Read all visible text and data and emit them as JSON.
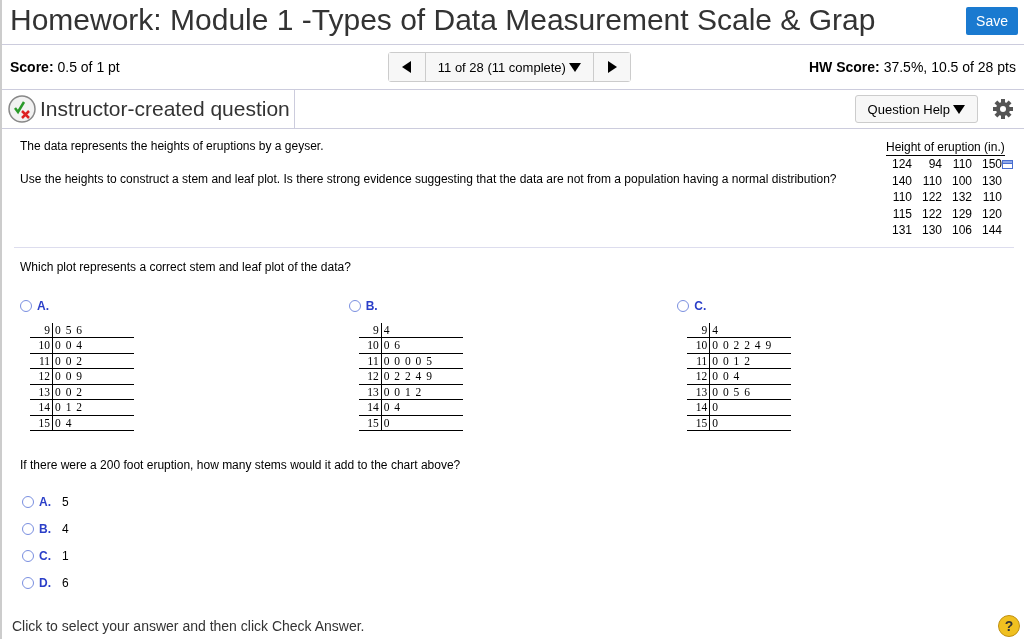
{
  "header": {
    "title": "Homework: Module 1 -Types of Data Measurement Scale & Grap",
    "save_button": "Save"
  },
  "score_bar": {
    "score_label": "Score:",
    "score": "0.5 of 1 pt",
    "nav": "11 of 28 (11 complete)",
    "hw_score_label": "HW Score:",
    "hw_score": "37.5%, 10.5 of 28 pts"
  },
  "question_bar": {
    "title": "Instructor-created question",
    "help_button": "Question Help"
  },
  "problem": {
    "intro": "The data represents the heights of eruptions by a geyser.",
    "task": "Use the heights to construct a stem and leaf plot. Is there strong evidence suggesting that the data are not from a population having a normal distribution?",
    "data_table": {
      "title": "Height of eruption (in.)",
      "rows": [
        [
          "124",
          "94",
          "110",
          "150"
        ],
        [
          "140",
          "110",
          "100",
          "130"
        ],
        [
          "110",
          "122",
          "132",
          "110"
        ],
        [
          "115",
          "122",
          "129",
          "120"
        ],
        [
          "131",
          "130",
          "106",
          "144"
        ]
      ]
    }
  },
  "part1": {
    "prompt": "Which plot represents a correct stem and leaf plot of the data?",
    "choices": [
      {
        "letter": "A.",
        "selected": false,
        "rows": [
          [
            "9",
            "0 5 6"
          ],
          [
            "10",
            "0 0 4"
          ],
          [
            "11",
            "0 0 2"
          ],
          [
            "12",
            "0 0 9"
          ],
          [
            "13",
            "0 0 2"
          ],
          [
            "14",
            "0 1 2"
          ],
          [
            "15",
            "0 4"
          ]
        ]
      },
      {
        "letter": "B.",
        "selected": false,
        "rows": [
          [
            "9",
            "4"
          ],
          [
            "10",
            "0 6"
          ],
          [
            "11",
            "0 0 0 0 5"
          ],
          [
            "12",
            "0 2 2 4 9"
          ],
          [
            "13",
            "0 0 1 2"
          ],
          [
            "14",
            "0 4"
          ],
          [
            "15",
            "0"
          ]
        ]
      },
      {
        "letter": "C.",
        "selected": false,
        "rows": [
          [
            "9",
            "4"
          ],
          [
            "10",
            "0 0 2 2 4 9"
          ],
          [
            "11",
            "0 0 1 2"
          ],
          [
            "12",
            "0 0 4"
          ],
          [
            "13",
            "0 0 5 6"
          ],
          [
            "14",
            "0"
          ],
          [
            "15",
            "0"
          ]
        ]
      }
    ]
  },
  "part2": {
    "prompt": "If there were a 200 foot eruption, how many stems would it add to the chart above?",
    "choices": [
      {
        "letter": "A.",
        "text": "5",
        "selected": false
      },
      {
        "letter": "B.",
        "text": "4",
        "selected": false
      },
      {
        "letter": "C.",
        "text": "1",
        "selected": false
      },
      {
        "letter": "D.",
        "text": "6",
        "selected": false
      }
    ]
  },
  "footer": {
    "instruction": "Click to select your answer and then click Check Answer.",
    "help_button": "?"
  }
}
